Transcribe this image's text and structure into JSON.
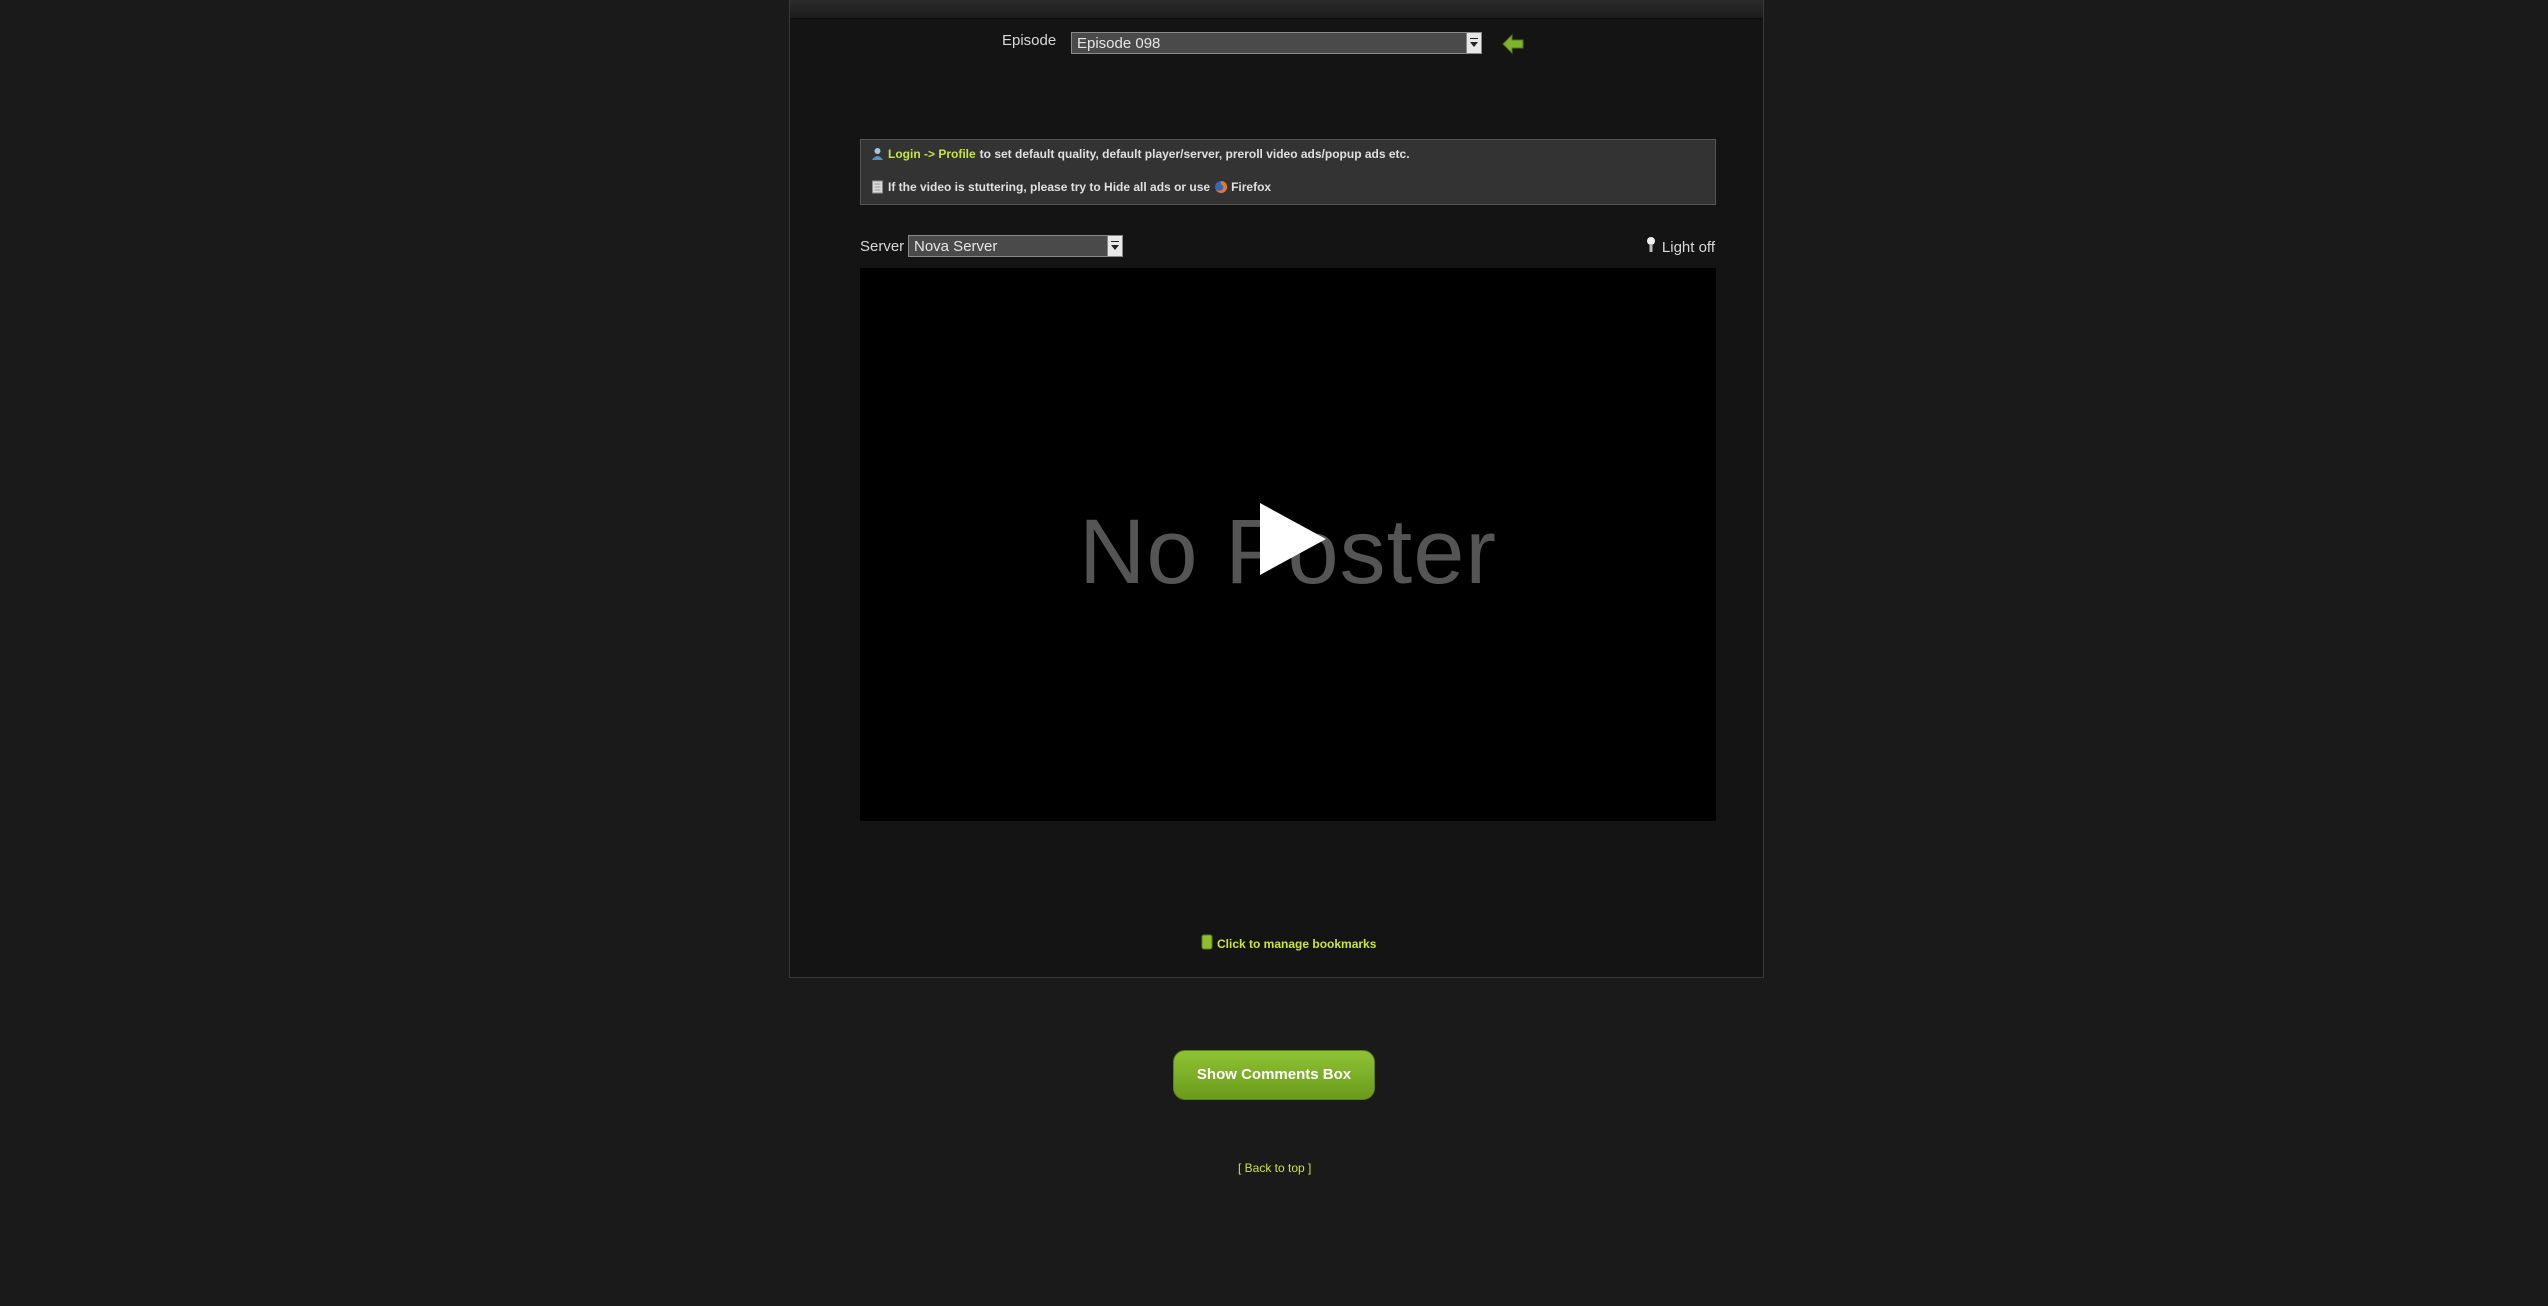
{
  "episode": {
    "label": "Episode",
    "selected": "Episode 098"
  },
  "notice": {
    "login_link": "Login -> Profile",
    "login_text": "to set default quality, default player/server, preroll video ads/popup ads etc.",
    "stutter_text": "If the video is stuttering, please try to Hide all ads or use",
    "firefox_label": "Firefox"
  },
  "server": {
    "label": "Server",
    "selected": "Nova Server"
  },
  "light_toggle": {
    "label": "Light off"
  },
  "player": {
    "poster_text": "No Poster"
  },
  "bookmarks": {
    "label": "Click to manage bookmarks"
  },
  "comments_button": {
    "label": "Show Comments Box"
  },
  "back_to_top": {
    "label": "[ Back to top ]"
  },
  "icons": {
    "back": "arrow-left-icon",
    "login": "user-icon",
    "stutter": "page-icon",
    "firefox": "firefox-icon",
    "light": "lightbulb-icon",
    "bookmark": "bookmark-icon"
  },
  "colors": {
    "accent_green": "#c8e63c",
    "button_green": "#7cb02a",
    "background": "#1a1a1a"
  }
}
